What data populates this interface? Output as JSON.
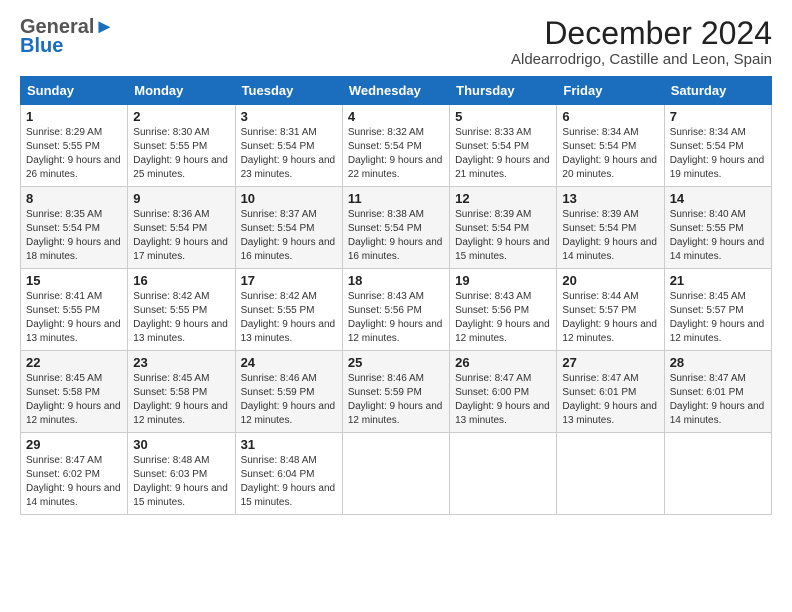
{
  "header": {
    "logo_general": "General",
    "logo_blue": "Blue",
    "title": "December 2024",
    "subtitle": "Aldearrodrigo, Castille and Leon, Spain"
  },
  "days_of_week": [
    "Sunday",
    "Monday",
    "Tuesday",
    "Wednesday",
    "Thursday",
    "Friday",
    "Saturday"
  ],
  "weeks": [
    [
      {
        "day": "1",
        "sunrise": "Sunrise: 8:29 AM",
        "sunset": "Sunset: 5:55 PM",
        "daylight": "Daylight: 9 hours and 26 minutes."
      },
      {
        "day": "2",
        "sunrise": "Sunrise: 8:30 AM",
        "sunset": "Sunset: 5:55 PM",
        "daylight": "Daylight: 9 hours and 25 minutes."
      },
      {
        "day": "3",
        "sunrise": "Sunrise: 8:31 AM",
        "sunset": "Sunset: 5:54 PM",
        "daylight": "Daylight: 9 hours and 23 minutes."
      },
      {
        "day": "4",
        "sunrise": "Sunrise: 8:32 AM",
        "sunset": "Sunset: 5:54 PM",
        "daylight": "Daylight: 9 hours and 22 minutes."
      },
      {
        "day": "5",
        "sunrise": "Sunrise: 8:33 AM",
        "sunset": "Sunset: 5:54 PM",
        "daylight": "Daylight: 9 hours and 21 minutes."
      },
      {
        "day": "6",
        "sunrise": "Sunrise: 8:34 AM",
        "sunset": "Sunset: 5:54 PM",
        "daylight": "Daylight: 9 hours and 20 minutes."
      },
      {
        "day": "7",
        "sunrise": "Sunrise: 8:34 AM",
        "sunset": "Sunset: 5:54 PM",
        "daylight": "Daylight: 9 hours and 19 minutes."
      }
    ],
    [
      {
        "day": "8",
        "sunrise": "Sunrise: 8:35 AM",
        "sunset": "Sunset: 5:54 PM",
        "daylight": "Daylight: 9 hours and 18 minutes."
      },
      {
        "day": "9",
        "sunrise": "Sunrise: 8:36 AM",
        "sunset": "Sunset: 5:54 PM",
        "daylight": "Daylight: 9 hours and 17 minutes."
      },
      {
        "day": "10",
        "sunrise": "Sunrise: 8:37 AM",
        "sunset": "Sunset: 5:54 PM",
        "daylight": "Daylight: 9 hours and 16 minutes."
      },
      {
        "day": "11",
        "sunrise": "Sunrise: 8:38 AM",
        "sunset": "Sunset: 5:54 PM",
        "daylight": "Daylight: 9 hours and 16 minutes."
      },
      {
        "day": "12",
        "sunrise": "Sunrise: 8:39 AM",
        "sunset": "Sunset: 5:54 PM",
        "daylight": "Daylight: 9 hours and 15 minutes."
      },
      {
        "day": "13",
        "sunrise": "Sunrise: 8:39 AM",
        "sunset": "Sunset: 5:54 PM",
        "daylight": "Daylight: 9 hours and 14 minutes."
      },
      {
        "day": "14",
        "sunrise": "Sunrise: 8:40 AM",
        "sunset": "Sunset: 5:55 PM",
        "daylight": "Daylight: 9 hours and 14 minutes."
      }
    ],
    [
      {
        "day": "15",
        "sunrise": "Sunrise: 8:41 AM",
        "sunset": "Sunset: 5:55 PM",
        "daylight": "Daylight: 9 hours and 13 minutes."
      },
      {
        "day": "16",
        "sunrise": "Sunrise: 8:42 AM",
        "sunset": "Sunset: 5:55 PM",
        "daylight": "Daylight: 9 hours and 13 minutes."
      },
      {
        "day": "17",
        "sunrise": "Sunrise: 8:42 AM",
        "sunset": "Sunset: 5:55 PM",
        "daylight": "Daylight: 9 hours and 13 minutes."
      },
      {
        "day": "18",
        "sunrise": "Sunrise: 8:43 AM",
        "sunset": "Sunset: 5:56 PM",
        "daylight": "Daylight: 9 hours and 12 minutes."
      },
      {
        "day": "19",
        "sunrise": "Sunrise: 8:43 AM",
        "sunset": "Sunset: 5:56 PM",
        "daylight": "Daylight: 9 hours and 12 minutes."
      },
      {
        "day": "20",
        "sunrise": "Sunrise: 8:44 AM",
        "sunset": "Sunset: 5:57 PM",
        "daylight": "Daylight: 9 hours and 12 minutes."
      },
      {
        "day": "21",
        "sunrise": "Sunrise: 8:45 AM",
        "sunset": "Sunset: 5:57 PM",
        "daylight": "Daylight: 9 hours and 12 minutes."
      }
    ],
    [
      {
        "day": "22",
        "sunrise": "Sunrise: 8:45 AM",
        "sunset": "Sunset: 5:58 PM",
        "daylight": "Daylight: 9 hours and 12 minutes."
      },
      {
        "day": "23",
        "sunrise": "Sunrise: 8:45 AM",
        "sunset": "Sunset: 5:58 PM",
        "daylight": "Daylight: 9 hours and 12 minutes."
      },
      {
        "day": "24",
        "sunrise": "Sunrise: 8:46 AM",
        "sunset": "Sunset: 5:59 PM",
        "daylight": "Daylight: 9 hours and 12 minutes."
      },
      {
        "day": "25",
        "sunrise": "Sunrise: 8:46 AM",
        "sunset": "Sunset: 5:59 PM",
        "daylight": "Daylight: 9 hours and 12 minutes."
      },
      {
        "day": "26",
        "sunrise": "Sunrise: 8:47 AM",
        "sunset": "Sunset: 6:00 PM",
        "daylight": "Daylight: 9 hours and 13 minutes."
      },
      {
        "day": "27",
        "sunrise": "Sunrise: 8:47 AM",
        "sunset": "Sunset: 6:01 PM",
        "daylight": "Daylight: 9 hours and 13 minutes."
      },
      {
        "day": "28",
        "sunrise": "Sunrise: 8:47 AM",
        "sunset": "Sunset: 6:01 PM",
        "daylight": "Daylight: 9 hours and 14 minutes."
      }
    ],
    [
      {
        "day": "29",
        "sunrise": "Sunrise: 8:47 AM",
        "sunset": "Sunset: 6:02 PM",
        "daylight": "Daylight: 9 hours and 14 minutes."
      },
      {
        "day": "30",
        "sunrise": "Sunrise: 8:48 AM",
        "sunset": "Sunset: 6:03 PM",
        "daylight": "Daylight: 9 hours and 15 minutes."
      },
      {
        "day": "31",
        "sunrise": "Sunrise: 8:48 AM",
        "sunset": "Sunset: 6:04 PM",
        "daylight": "Daylight: 9 hours and 15 minutes."
      },
      null,
      null,
      null,
      null
    ]
  ]
}
